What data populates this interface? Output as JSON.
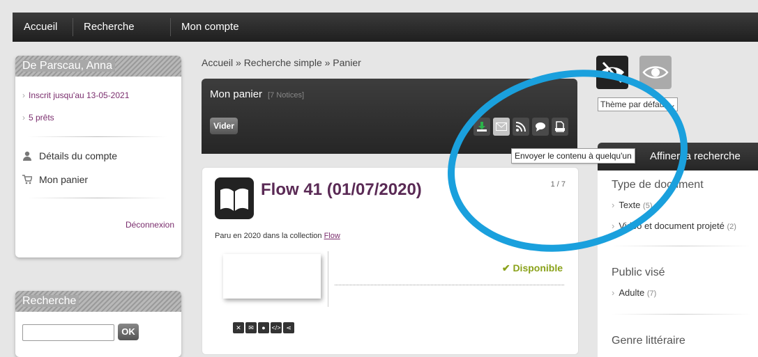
{
  "nav": {
    "home": "Accueil",
    "search": "Recherche",
    "account": "Mon compte"
  },
  "user": {
    "name": "De Parscau, Anna",
    "registered": "Inscrit jusqu'au 13-05-2021",
    "loans": "5 prêts",
    "details": "Détails du compte",
    "cart": "Mon panier",
    "logout": "Déconnexion"
  },
  "search_box": {
    "title": "Recherche",
    "value": "",
    "ok": "OK"
  },
  "breadcrumb": "Accueil » Recherche simple » Panier",
  "cart": {
    "title": "Mon panier",
    "count": "[7 Notices]",
    "empty_button": "Vider",
    "tooltip": "Envoyer le contenu à quelqu'un",
    "tools": [
      "download-icon",
      "mail-icon",
      "rss-icon",
      "comment-icon",
      "print-icon"
    ]
  },
  "notice": {
    "title": "Flow 41 (01/07/2020)",
    "page": "1 / 7",
    "desc_prefix": "Paru en 2020 dans la collection ",
    "collection": "Flow",
    "availability": "Disponible"
  },
  "sidebar_right": {
    "theme": "Thème par défaut",
    "facet_title": "Affiner la recherche par",
    "groups": [
      {
        "title": "Type de document",
        "items": [
          {
            "label": "Texte",
            "count": "(5)"
          },
          {
            "label": "Vidéo et document projeté",
            "count": "(2)"
          }
        ]
      },
      {
        "title": "Public visé",
        "items": [
          {
            "label": "Adulte",
            "count": "(7)"
          }
        ]
      },
      {
        "title": "Genre littéraire",
        "items": []
      }
    ]
  },
  "colors": {
    "accent": "#7a2d6d",
    "annotation": "#1aa0dd",
    "available": "#8aa21a"
  }
}
